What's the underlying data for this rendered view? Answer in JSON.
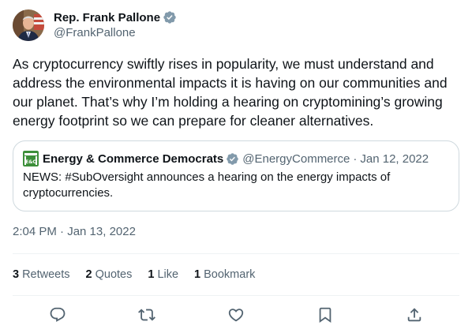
{
  "author": {
    "display_name": "Rep. Frank Pallone",
    "handle": "@FrankPallone",
    "verified_icon": "verified-badge-icon"
  },
  "tweet": {
    "text": "As cryptocurrency swiftly rises in popularity, we must understand and address the environmental impacts it is having on our communities and our planet. That’s why I’m holding a hearing on cryptomining’s growing energy footprint so we can prepare for cleaner alternatives.",
    "timestamp": "2:04 PM · Jan 13, 2022"
  },
  "quote": {
    "display_name": "Energy & Commerce Democrats",
    "handle": "@EnergyCommerce",
    "separator": "·",
    "date": "Jan 12, 2022",
    "text": "NEWS: #SubOversight announces a hearing on the energy impacts of cryptocurrencies.",
    "logo_text": "E&C",
    "logo_color": "#3d8f3a"
  },
  "stats": {
    "retweets_count": "3",
    "retweets_label": "Retweets",
    "quotes_count": "2",
    "quotes_label": "Quotes",
    "likes_count": "1",
    "likes_label": "Like",
    "bookmarks_count": "1",
    "bookmarks_label": "Bookmark"
  },
  "actions": [
    "reply-icon",
    "retweet-icon",
    "like-icon",
    "bookmark-icon",
    "share-icon"
  ],
  "colors": {
    "text": "#0f1419",
    "secondary": "#536471",
    "border": "#cfd9de",
    "divider": "#eff3f4",
    "verified": "#829aab"
  }
}
